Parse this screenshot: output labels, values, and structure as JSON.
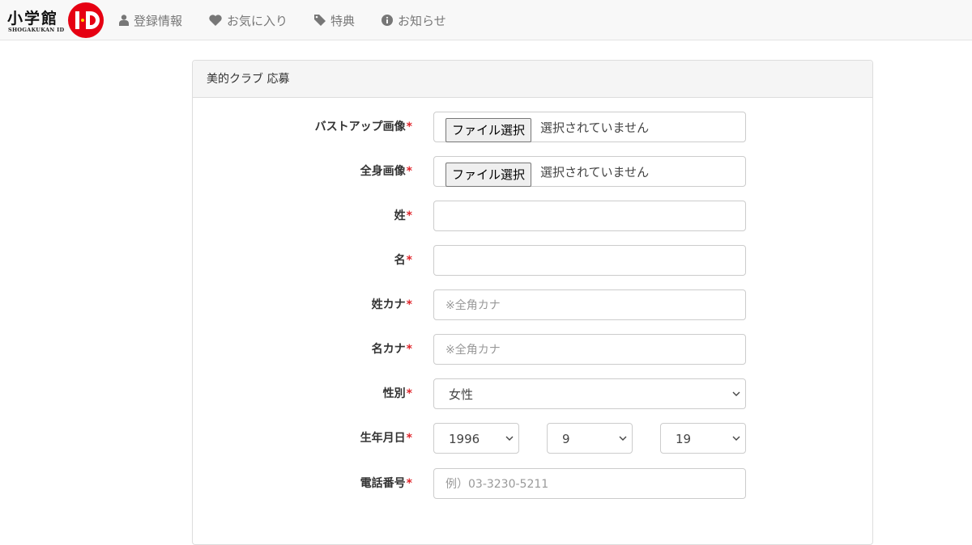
{
  "brand": {
    "jp": "小学館",
    "en": "SHOGAKUKAN ID",
    "id_mark": "I·D"
  },
  "nav": [
    {
      "label": "登録情報",
      "icon": "user-icon"
    },
    {
      "label": "お気に入り",
      "icon": "heart-icon"
    },
    {
      "label": "特典",
      "icon": "tag-icon"
    },
    {
      "label": "お知らせ",
      "icon": "info-circle-icon"
    }
  ],
  "panel": {
    "title": "美的クラブ 応募"
  },
  "form": {
    "required_mark": "*",
    "bust_image": {
      "label": "バストアップ画像",
      "button": "ファイル選択",
      "status": "選択されていません"
    },
    "full_image": {
      "label": "全身画像",
      "button": "ファイル選択",
      "status": "選択されていません"
    },
    "last_name": {
      "label": "姓",
      "value": ""
    },
    "first_name": {
      "label": "名",
      "value": ""
    },
    "last_kana": {
      "label": "姓カナ",
      "placeholder": "※全角カナ"
    },
    "first_kana": {
      "label": "名カナ",
      "placeholder": "※全角カナ"
    },
    "gender": {
      "label": "性別",
      "selected": "女性"
    },
    "birthday": {
      "label": "生年月日",
      "year": "1996",
      "month": "9",
      "day": "19"
    },
    "phone": {
      "label": "電話番号",
      "placeholder": "例）03-3230-5211"
    }
  },
  "colors": {
    "required": "#e0262c",
    "logo_red": "#e60012"
  }
}
